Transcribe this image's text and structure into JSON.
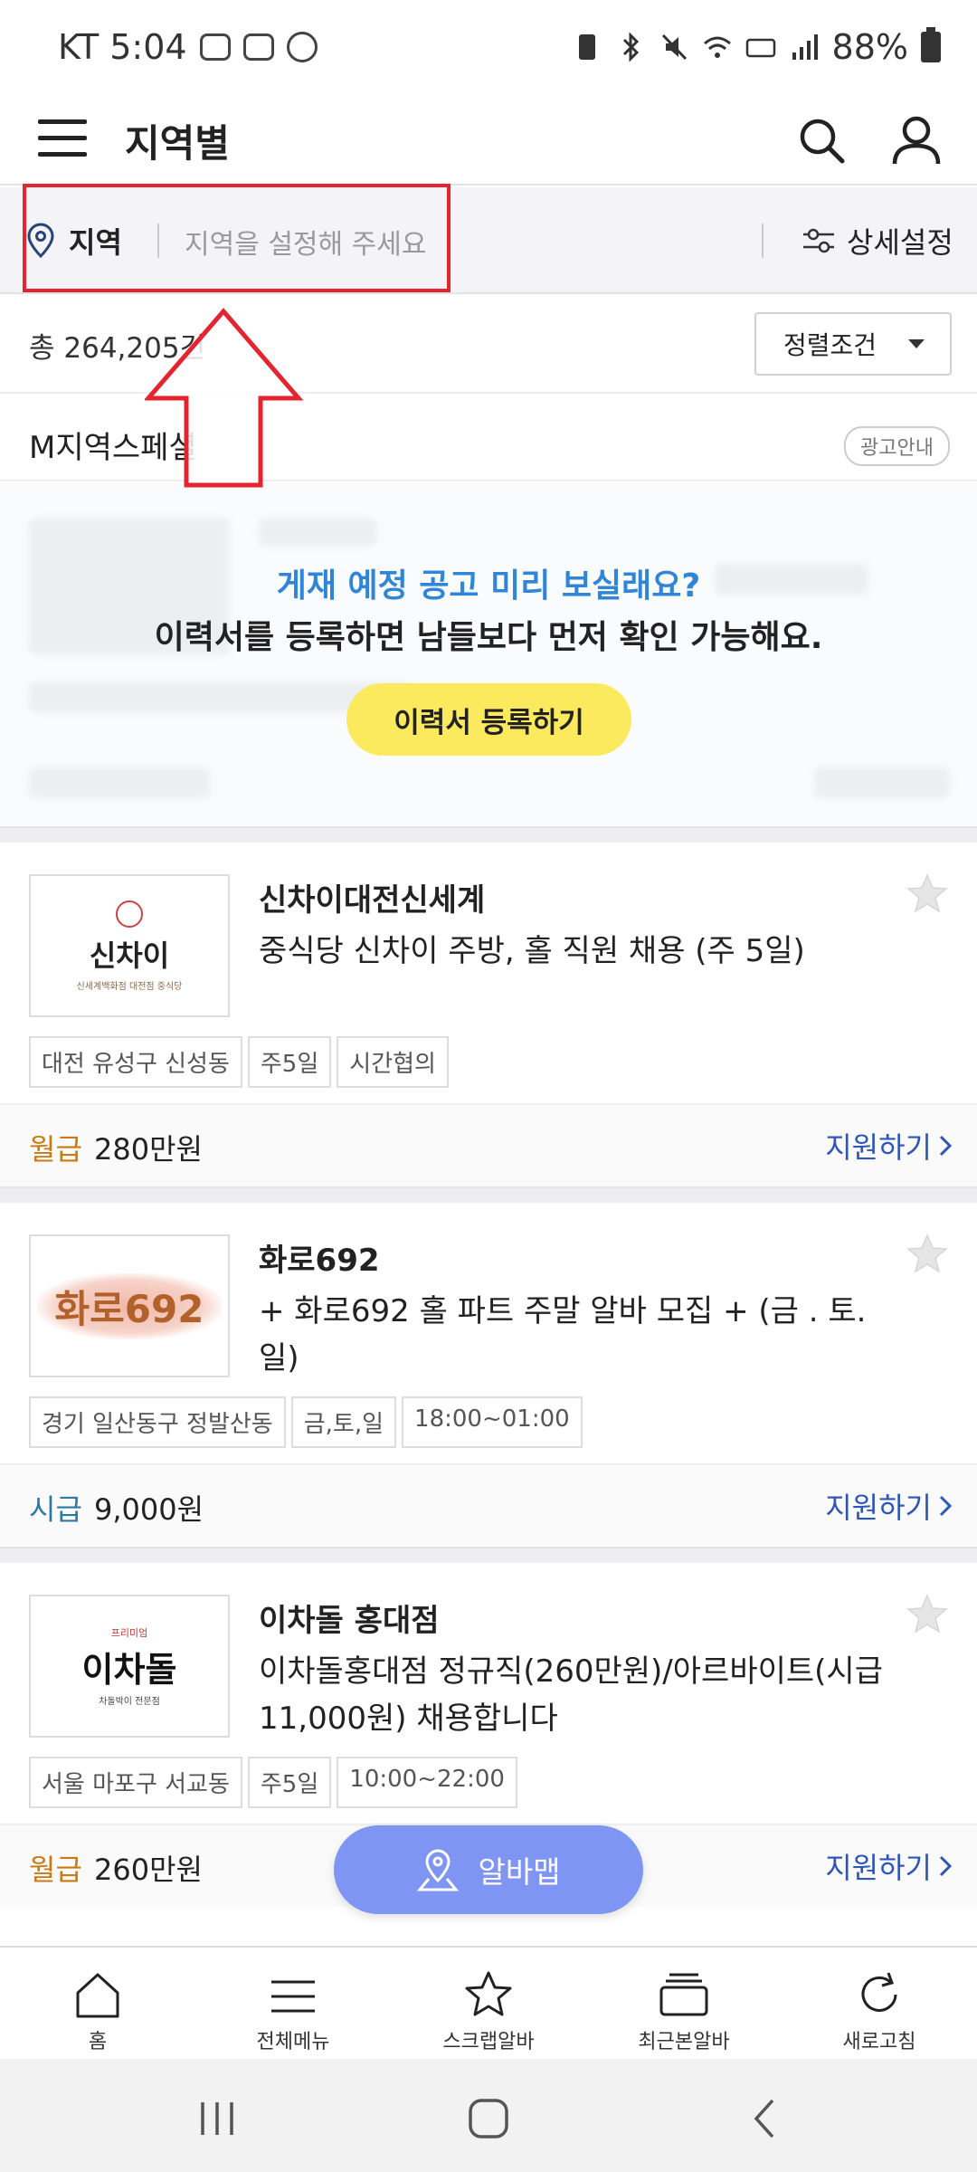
{
  "status_bar": {
    "carrier_time": "KT 5:04",
    "battery": "88%"
  },
  "header": {
    "title": "지역별"
  },
  "filter": {
    "region_label": "지역",
    "region_placeholder": "지역을 설정해 주세요",
    "detail_label": "상세설정"
  },
  "results": {
    "count": "총 264,205건",
    "sort_label": "정렬조건"
  },
  "section": {
    "title": "M지역스페셜",
    "ad_badge": "광고안내"
  },
  "promo": {
    "question": "게재 예정 공고 미리 보실래요?",
    "message": "이력서를 등록하면 남들보다 먼저 확인 가능해요.",
    "button": "이력서 등록하기"
  },
  "jobs": [
    {
      "company": "신차이대전신세계",
      "title": "중식당 신차이 주방, 홀 직원 채용 (주 5일)",
      "logo_text": "신차이",
      "logo_sub": "신세계백화점 대전점 중식당",
      "tags": [
        "대전 유성구 신성동",
        "주5일",
        "시간협의"
      ],
      "pay_type": "월급",
      "pay_amount": "280만원",
      "apply": "지원하기"
    },
    {
      "company": "화로692",
      "title": "+ 화로692 홀 파트 주말 알바 모집 + (금 . 토. 일)",
      "logo_text": "화로692",
      "tags": [
        "경기 일산동구 정발산동",
        "금,토,일",
        "18:00~01:00"
      ],
      "pay_type": "시급",
      "pay_amount": "9,000원",
      "apply": "지원하기"
    },
    {
      "company": "이차돌 홍대점",
      "title": "이차돌홍대점 정규직(260만원)/아르바이트(시급11,000원) 채용합니다",
      "logo_sub": "프리미엄",
      "logo_text": "이차돌",
      "logo_sub2": "차돌박이 전문점",
      "tags": [
        "서울 마포구 서교동",
        "주5일",
        "10:00~22:00"
      ],
      "pay_type": "월급",
      "pay_amount": "260만원",
      "apply": "지원하기"
    }
  ],
  "map_button": "알바맵",
  "bottom_nav": [
    {
      "label": "홈",
      "icon": "home-icon"
    },
    {
      "label": "전체메뉴",
      "icon": "menu-icon"
    },
    {
      "label": "스크랩알바",
      "icon": "star-icon"
    },
    {
      "label": "최근본알바",
      "icon": "stack-icon"
    },
    {
      "label": "새로고침",
      "icon": "refresh-icon"
    }
  ],
  "colors": {
    "highlight": "#e4242e",
    "promo_blue": "#2f86d9",
    "promo_button": "#fbe95e",
    "map_button": "#7f95f4",
    "apply_link": "#2d56b8"
  }
}
